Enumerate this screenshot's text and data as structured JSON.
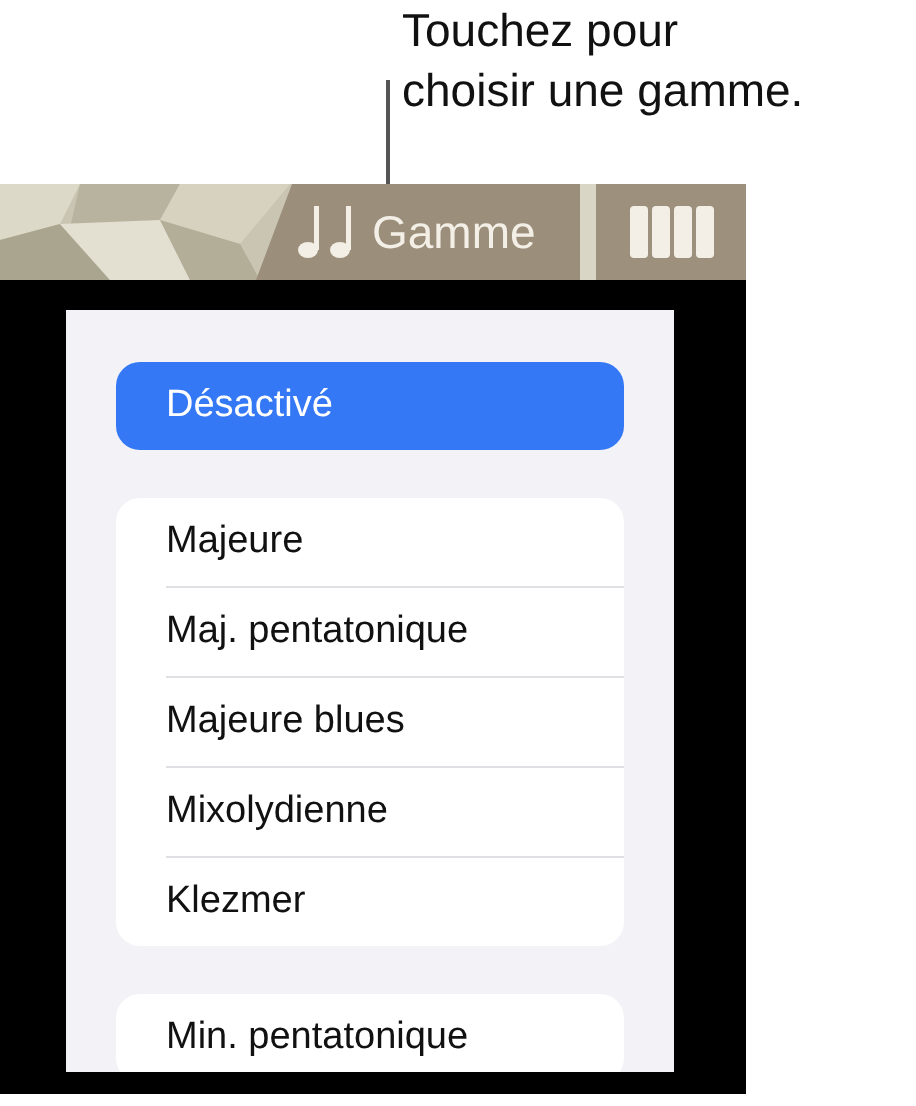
{
  "callout": "Touchez pour\nchoisir une gamme.",
  "toolbar": {
    "scale_button": "Gamme"
  },
  "off_option": {
    "label": "Désactivé",
    "selected": true
  },
  "groups": [
    {
      "items": [
        {
          "label": "Majeure",
          "selected": false
        },
        {
          "label": "Maj. pentatonique",
          "selected": false
        },
        {
          "label": "Majeure blues",
          "selected": false
        },
        {
          "label": "Mixolydienne",
          "selected": false
        },
        {
          "label": "Klezmer",
          "selected": false
        }
      ]
    },
    {
      "items": [
        {
          "label": "Min. pentatonique",
          "selected": false
        }
      ]
    }
  ]
}
